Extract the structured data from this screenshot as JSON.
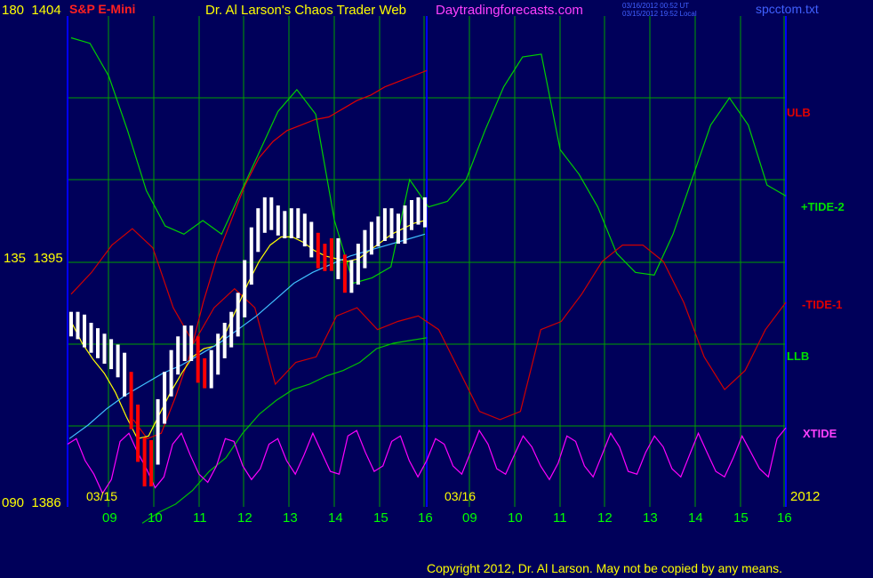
{
  "header": {
    "scale_top": "180  1404",
    "instrument": "S&P E-Mini",
    "title": "Dr. Al Larson's Chaos Trader Web",
    "site": "Daytradingforecasts.com",
    "timestamp_ut": "03/16/2012 00:52 UT",
    "timestamp_local": "03/15/2012 19:52 Local",
    "filename": "spcctom.txt"
  },
  "axis": {
    "scale_mid": "135  1395",
    "scale_bottom": "090  1386",
    "day1": "03/15",
    "day2": "03/16",
    "year": "2012",
    "hours_day1": [
      "09",
      "10",
      "11",
      "12",
      "13",
      "14",
      "15",
      "16"
    ],
    "hours_day2": [
      "09",
      "10",
      "11",
      "12",
      "13",
      "14",
      "15",
      "16"
    ]
  },
  "labels": {
    "ulb": "ULB",
    "tide2": "+TIDE-2",
    "tide1": "-TIDE-1",
    "llb": "LLB",
    "xtide": "XTIDE"
  },
  "footer": {
    "copyright": "Copyright 2012, Dr. Al Larson. May not be copied by any means."
  },
  "colors": {
    "background": "#00005a",
    "grid": "#00a000",
    "frame": "#0000ff",
    "price_bar": "#ffffff",
    "price_bar_down": "#ff0000",
    "ulb": "#e00000",
    "tide2": "#00d000",
    "tide1": "#d00000",
    "llb": "#00c000",
    "xtide": "#ff00ff",
    "avg_fast": "#ffff00",
    "avg_slow": "#40c0ff",
    "text_yellow": "#ffff00",
    "text_green": "#00ff00",
    "text_red": "#ff2020",
    "text_magenta": "#ff40ff",
    "text_blue": "#4060ff"
  },
  "chart_data": {
    "type": "line",
    "title": "S&P E-Mini",
    "y_left_scale": [
      90,
      180
    ],
    "y_price_scale": [
      1386,
      1404
    ],
    "x_ticks_day1": [
      "09",
      "10",
      "11",
      "12",
      "13",
      "14",
      "15",
      "16"
    ],
    "x_ticks_day2": [
      "09",
      "10",
      "11",
      "12",
      "13",
      "14",
      "15",
      "16"
    ],
    "price_close": [
      1392.7,
      1392.6,
      1392.3,
      1392.1,
      1391.9,
      1391.7,
      1391.5,
      1391.2,
      1390.5,
      1389.3,
      1388.1,
      1387.2,
      1388.0,
      1389.5,
      1390.5,
      1391.3,
      1391.8,
      1392.2,
      1391.8,
      1391.0,
      1390.8,
      1391.3,
      1391.9,
      1392.3,
      1392.7,
      1393.4,
      1394.6,
      1395.8,
      1396.5,
      1396.9,
      1396.6,
      1396.4,
      1396.3,
      1396.5,
      1396.3,
      1396.0,
      1395.6,
      1395.2,
      1395.1,
      1395.4,
      1394.8,
      1394.3,
      1394.6,
      1395.2,
      1395.7,
      1396.0,
      1396.2,
      1396.5,
      1396.3,
      1396.1,
      1396.6,
      1396.8,
      1396.9,
      1396.7
    ],
    "price_bar_down_indices": [
      9,
      10,
      11,
      12,
      19,
      20,
      37,
      38,
      39,
      41
    ],
    "price_avg_fast": [
      1392.8,
      1392.0,
      1391.4,
      1390.9,
      1390.2,
      1389.3,
      1388.5,
      1388.6,
      1389.4,
      1390.2,
      1390.9,
      1391.5,
      1391.8,
      1391.9,
      1392.4,
      1393.3,
      1394.2,
      1395.0,
      1395.6,
      1395.9,
      1395.9,
      1395.7,
      1395.4,
      1395.2,
      1395.1,
      1395.0,
      1395.1,
      1395.4,
      1395.7,
      1396.0,
      1396.2,
      1396.4,
      1396.5
    ],
    "price_avg_slow": [
      1388.5,
      1389.0,
      1389.6,
      1390.1,
      1390.5,
      1390.9,
      1391.2,
      1391.6,
      1392.0,
      1392.5,
      1393.0,
      1393.6,
      1394.2,
      1394.6,
      1394.9,
      1395.2,
      1395.4,
      1395.6,
      1395.8,
      1396.0
    ],
    "series": [
      {
        "name": "ULB",
        "values": [
          1389.2,
          1388.5,
          1388.7,
          1390.0,
          1391.5,
          1393.5,
          1395.2,
          1396.5,
          1397.8,
          1398.8,
          1399.4,
          1399.8,
          1400.0,
          1400.2,
          1400.3,
          1400.6,
          1400.9,
          1401.1,
          1401.4,
          1401.6,
          1401.8,
          1402.0
        ]
      },
      {
        "name": "+TIDE-2",
        "values": [
          1403.2,
          1403.0,
          1401.8,
          1399.8,
          1397.6,
          1396.3,
          1396.0,
          1396.5,
          1396.0,
          1397.5,
          1399.0,
          1400.5,
          1401.3,
          1400.4,
          1396.5,
          1394.2,
          1394.4,
          1394.8,
          1398.0,
          1397.0,
          1397.2,
          1398.0,
          1399.8,
          1401.4,
          1402.5,
          1402.6,
          1399.1,
          1398.2,
          1397.0,
          1395.3,
          1394.6,
          1394.5,
          1396.0,
          1398.0,
          1400.0,
          1401.0,
          1400.0,
          1397.8,
          1397.4
        ]
      },
      {
        "name": "-TIDE-1",
        "values": [
          1393.8,
          1394.6,
          1395.6,
          1396.2,
          1395.5,
          1393.3,
          1392.0,
          1393.3,
          1394.0,
          1393.3,
          1390.5,
          1391.3,
          1391.5,
          1393.0,
          1393.3,
          1392.5,
          1392.8,
          1393.0,
          1392.5,
          1391.0,
          1389.5,
          1389.2,
          1389.5,
          1392.5,
          1392.8,
          1393.8,
          1395.0,
          1395.6,
          1395.6,
          1395.0,
          1393.5,
          1391.5,
          1390.3,
          1391.0,
          1392.5,
          1393.5
        ]
      },
      {
        "name": "LLB",
        "values": [
          1385.4,
          1385.8,
          1386.1,
          1386.6,
          1387.3,
          1387.8,
          1388.7,
          1389.4,
          1389.9,
          1390.3,
          1390.5,
          1390.8,
          1391.0,
          1391.3,
          1391.8,
          1392.0,
          1392.1,
          1392.2
        ]
      },
      {
        "name": "XTIDE",
        "values": [
          1388.3,
          1388.5,
          1387.7,
          1387.2,
          1386.5,
          1387.0,
          1388.4,
          1388.7,
          1388.0,
          1387.4,
          1386.7,
          1387.1,
          1388.3,
          1388.7,
          1387.9,
          1387.2,
          1386.9,
          1387.5,
          1388.5,
          1388.4,
          1387.5,
          1387.0,
          1387.4,
          1388.3,
          1388.5,
          1387.7,
          1387.2,
          1387.9,
          1388.7,
          1388.0,
          1387.3,
          1387.2,
          1388.6,
          1388.8,
          1388.0,
          1387.3,
          1387.5,
          1388.4,
          1388.6,
          1387.7,
          1387.1,
          1387.7,
          1388.5,
          1388.3,
          1387.5,
          1387.2,
          1388.0,
          1388.8,
          1388.3,
          1387.4,
          1387.2,
          1387.9,
          1388.6,
          1388.2,
          1387.5,
          1387.0,
          1387.6,
          1388.6,
          1388.4,
          1387.5,
          1387.1,
          1387.9,
          1388.7,
          1388.2,
          1387.3,
          1387.2,
          1388.0,
          1388.6,
          1388.2,
          1387.4,
          1387.1,
          1387.9,
          1388.7,
          1388.0,
          1387.3,
          1387.1,
          1387.8,
          1388.6,
          1388.0,
          1387.4,
          1387.1,
          1388.5,
          1388.9
        ]
      }
    ],
    "grid": true
  }
}
